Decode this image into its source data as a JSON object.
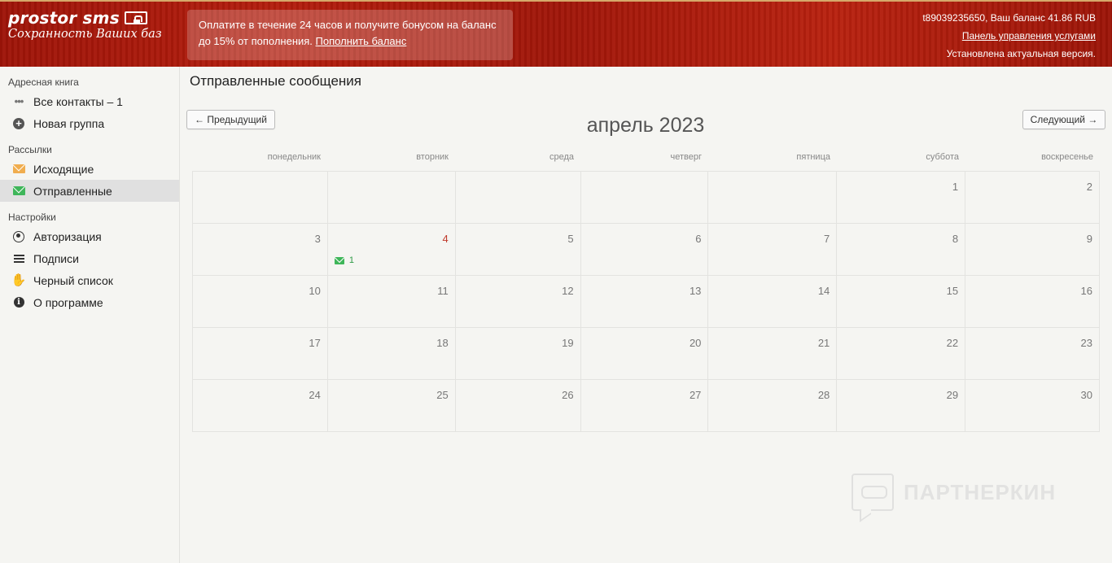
{
  "header": {
    "logo_name": "prostor sms",
    "logo_tagline": "Сохранность Ваших баз",
    "promo_text": "Оплатите в течение 24 часов и получите бонусом на баланс до 15% от пополнения.",
    "promo_link": "Пополнить баланс",
    "account_line": "t89039235650, Ваш баланс 41.86 RUB",
    "panel_link": "Панель управления услугами",
    "version_text": "Установлена актуальная версия."
  },
  "sidebar": {
    "address_book_heading": "Адресная книга",
    "all_contacts": "Все контакты – 1",
    "new_group": "Новая группа",
    "mailings_heading": "Рассылки",
    "outgoing": "Исходящие",
    "sent": "Отправленные",
    "settings_heading": "Настройки",
    "authorization": "Авторизация",
    "signatures": "Подписи",
    "blacklist": "Черный список",
    "about": "О программе"
  },
  "main": {
    "title": "Отправленные сообщения",
    "prev_label": "← Предыдущий",
    "next_label": "Следующий →",
    "month_label": "апрель 2023"
  },
  "calendar": {
    "weekdays": [
      "понедельник",
      "вторник",
      "среда",
      "четверг",
      "пятница",
      "суббота",
      "воскресенье"
    ],
    "weeks": [
      [
        "",
        "",
        "",
        "",
        "",
        "1",
        "2"
      ],
      [
        "3",
        "4",
        "5",
        "6",
        "7",
        "8",
        "9"
      ],
      [
        "10",
        "11",
        "12",
        "13",
        "14",
        "15",
        "16"
      ],
      [
        "17",
        "18",
        "19",
        "20",
        "21",
        "22",
        "23"
      ],
      [
        "24",
        "25",
        "26",
        "27",
        "28",
        "29",
        "30"
      ]
    ],
    "today": "4",
    "sent_counts": {
      "4": "1"
    }
  },
  "watermark": "ПАРТНЕРКИН",
  "colors": {
    "header_red": "#a8190b",
    "accent_green": "#3fb65a",
    "accent_yellow": "#f0ad4e",
    "today_red": "#c0392b"
  },
  "icons": {
    "all_contacts": "ellipsis-icon",
    "new_group": "plus-circle-icon",
    "outgoing": "envelope-icon",
    "sent": "envelope-icon",
    "authorization": "user-circle-icon",
    "signatures": "list-icon",
    "blacklist": "hand-icon",
    "about": "info-icon"
  }
}
